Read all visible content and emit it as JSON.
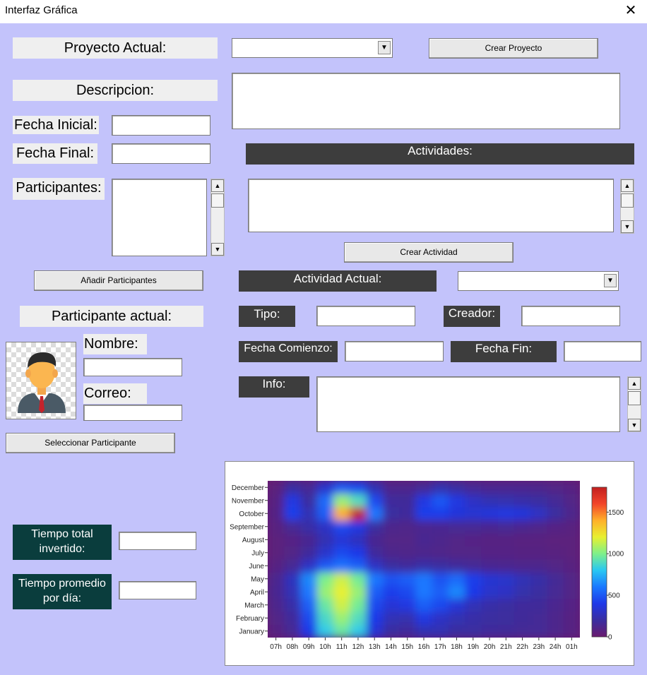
{
  "window": {
    "title": "Interfaz Gráfica",
    "close_glyph": "✕"
  },
  "project": {
    "label": "Proyecto Actual:",
    "selected": "",
    "create_button": "Crear Proyecto",
    "description_label": "Descripcion:",
    "description_value": "",
    "start_date_label": "Fecha Inicial:",
    "start_date_value": "",
    "end_date_label": "Fecha Final:",
    "end_date_value": "",
    "participants_label": "Participantes:",
    "add_participants_button": "Añadir Participantes"
  },
  "participant": {
    "header": "Participante actual:",
    "name_label": "Nombre:",
    "name_value": "",
    "email_label": "Correo:",
    "email_value": "",
    "select_button": "Seleccionar Participante"
  },
  "activities": {
    "header": "Actividades:",
    "create_button": "Crear Actividad",
    "current_label": "Actividad Actual:",
    "current_selected": "",
    "type_label": "Tipo:",
    "type_value": "",
    "creator_label": "Creador:",
    "creator_value": "",
    "start_label": "Fecha Comienzo:",
    "start_value": "",
    "end_label": "Fecha Fin:",
    "end_value": "",
    "info_label": "Info:",
    "info_value": ""
  },
  "stats": {
    "total_time_label_1": "Tiempo total",
    "total_time_label_2": "invertido:",
    "total_time_value": "",
    "avg_time_label_1": "Tiempo promedio",
    "avg_time_label_2": "por día:",
    "avg_time_value": ""
  },
  "icons": {
    "combo_arrow": "▼",
    "scroll_up": "▲",
    "scroll_down": "▼"
  },
  "chart_data": {
    "type": "heatmap",
    "title": "",
    "xlabel": "",
    "ylabel": "",
    "x": [
      "07h",
      "08h",
      "09h",
      "10h",
      "11h",
      "12h",
      "13h",
      "14h",
      "15h",
      "16h",
      "17h",
      "18h",
      "19h",
      "20h",
      "21h",
      "22h",
      "23h",
      "24h",
      "01h"
    ],
    "y": [
      "January",
      "February",
      "March",
      "April",
      "May",
      "June",
      "July",
      "August",
      "September",
      "October",
      "November",
      "December"
    ],
    "colorbar": {
      "min": 0,
      "max": 1800,
      "ticks": [
        0,
        500,
        1000,
        1500
      ]
    },
    "colormap": [
      "#6a1b6e",
      "#3a2ea0",
      "#1f38e8",
      "#1a78ff",
      "#29c7f2",
      "#7ef08a",
      "#e8f030",
      "#ffb02a",
      "#f2452a",
      "#c21f1f"
    ],
    "values": [
      [
        80,
        150,
        400,
        820,
        950,
        820,
        350,
        200,
        180,
        250,
        250,
        200,
        200,
        180,
        170,
        160,
        160,
        120,
        80
      ],
      [
        100,
        180,
        450,
        880,
        1050,
        900,
        400,
        260,
        240,
        380,
        300,
        250,
        220,
        200,
        190,
        170,
        160,
        120,
        80
      ],
      [
        120,
        220,
        520,
        950,
        1150,
        980,
        450,
        350,
        380,
        520,
        450,
        350,
        260,
        220,
        200,
        180,
        170,
        130,
        90
      ],
      [
        140,
        260,
        600,
        1050,
        1200,
        1050,
        520,
        420,
        450,
        600,
        520,
        640,
        400,
        320,
        300,
        230,
        200,
        150,
        100
      ],
      [
        130,
        280,
        640,
        1000,
        1150,
        980,
        600,
        480,
        520,
        600,
        480,
        560,
        420,
        340,
        320,
        260,
        220,
        160,
        100
      ],
      [
        80,
        150,
        300,
        500,
        580,
        520,
        300,
        200,
        180,
        220,
        200,
        180,
        160,
        140,
        130,
        120,
        120,
        100,
        70
      ],
      [
        60,
        100,
        180,
        320,
        450,
        400,
        180,
        120,
        110,
        120,
        110,
        100,
        100,
        90,
        90,
        80,
        80,
        70,
        60
      ],
      [
        60,
        90,
        140,
        250,
        350,
        280,
        140,
        100,
        100,
        140,
        120,
        100,
        90,
        80,
        80,
        70,
        70,
        60,
        60
      ],
      [
        70,
        150,
        220,
        300,
        450,
        380,
        200,
        120,
        110,
        130,
        140,
        150,
        150,
        140,
        150,
        130,
        110,
        90,
        70
      ],
      [
        90,
        420,
        260,
        520,
        1400,
        1900,
        600,
        200,
        180,
        420,
        420,
        360,
        340,
        360,
        380,
        360,
        300,
        200,
        120
      ],
      [
        80,
        380,
        200,
        560,
        1050,
        900,
        450,
        180,
        170,
        380,
        500,
        380,
        300,
        250,
        240,
        220,
        200,
        160,
        100
      ],
      [
        60,
        200,
        150,
        320,
        500,
        450,
        250,
        120,
        120,
        160,
        240,
        200,
        150,
        130,
        130,
        130,
        120,
        100,
        80
      ]
    ]
  }
}
